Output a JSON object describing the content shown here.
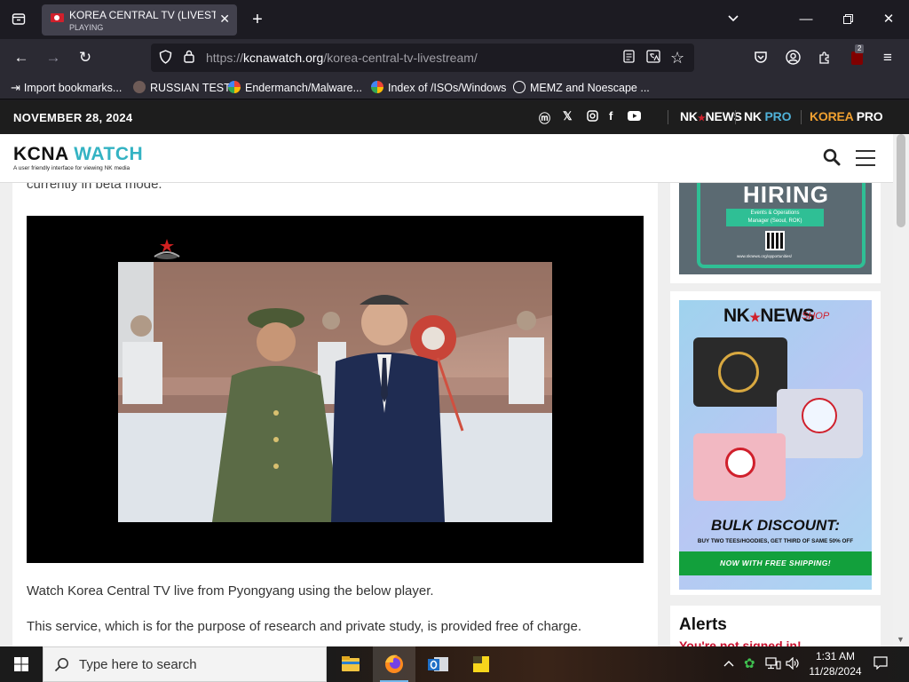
{
  "browser": {
    "tab": {
      "title": "KOREA CENTRAL TV (LIVESTREAM)",
      "status": "PLAYING"
    },
    "address": {
      "scheme": "https://",
      "domain": "kcnawatch.org",
      "path": "/korea-central-tv-livestream/"
    },
    "extension_badge": "2",
    "bookmarks": [
      {
        "label": "Import bookmarks...",
        "icon": "import-icon"
      },
      {
        "label": "RUSSIAN TEST",
        "icon": "github-icon"
      },
      {
        "label": "Endermanch/Malware...",
        "icon": "google-icon"
      },
      {
        "label": "Index of /ISOs/Windows",
        "icon": "google-icon"
      },
      {
        "label": "MEMZ and Noescape ...",
        "icon": "globe-icon"
      }
    ]
  },
  "site": {
    "date": "NOVEMBER 28, 2024",
    "brands": {
      "nknews_a": "NK",
      "nknews_b": "NEWS",
      "nkpro_a": "NK",
      "nkpro_b": "PRO",
      "koreapro_a": "KOREA",
      "koreapro_b": "PRO"
    },
    "logo": {
      "part1": "KCNA",
      "part2": "WATCH",
      "tagline": "A user friendly interface for viewing NK media"
    }
  },
  "article": {
    "cut_text": "currently in beta mode.",
    "paragraph1": "Watch Korea Central TV live from Pyongyang using the below player.",
    "paragraph2": "This service, which is for the purpose of research and private study, is provided free of charge."
  },
  "sidebar": {
    "hiring": {
      "title": "HIRING",
      "role_line1": "Events & Operations",
      "role_line2": "Manager (Seoul, ROK)",
      "link": "www.nknews.org/opportunities/"
    },
    "shop": {
      "brand_a": "NK",
      "brand_b": "NEWS",
      "shop_label": "SHOP",
      "headline": "BULK DISCOUNT:",
      "subline": "BUY TWO TEES/HOODIES, GET THIRD OF SAME 50% OFF",
      "banner": "NOW WITH FREE SHIPPING!"
    },
    "alerts": {
      "title": "Alerts",
      "status": "You're not signed in!"
    }
  },
  "taskbar": {
    "search_placeholder": "Type here to search",
    "time": "1:31 AM",
    "date": "11/28/2024"
  },
  "colors": {
    "accent_teal": "#34b3c3",
    "nkpro_blue": "#4fb1d8",
    "koreapro_orange": "#f0a030",
    "red": "#c8102e",
    "shop_green": "#12a03c"
  }
}
